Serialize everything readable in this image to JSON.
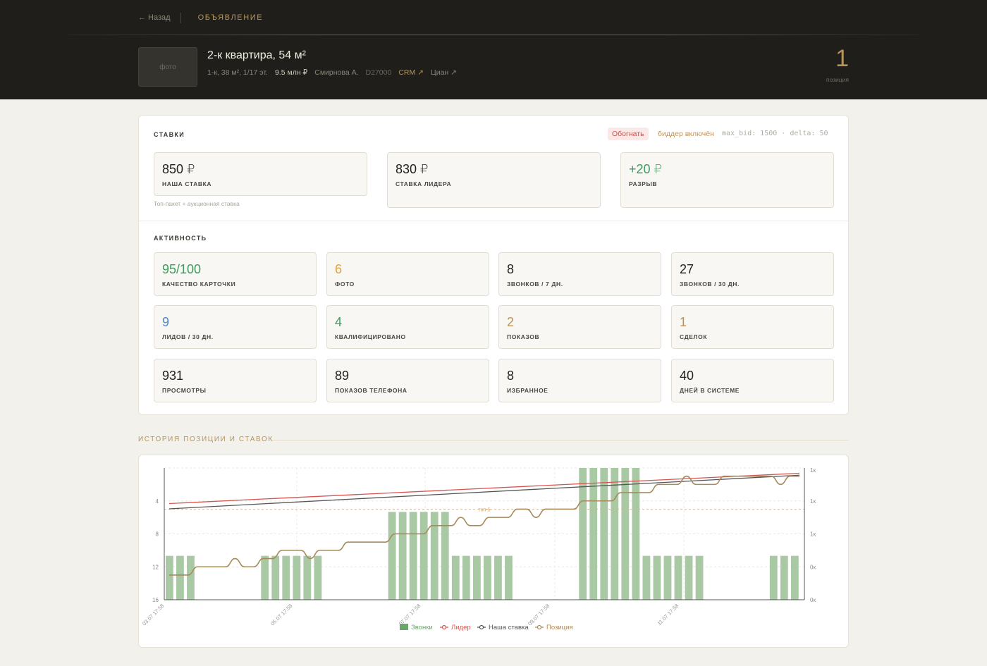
{
  "header": {
    "back_label": "← Назад",
    "crumb": "ОБЪЯВЛЕНИЕ",
    "photo_label": "фото",
    "title": "2-к квартира, 54 м²",
    "meta": {
      "details": "1-к, 38 м², 1/17 эт.",
      "price": "9.5 млн ₽",
      "agent": "Смирнова А.",
      "code": "D27000",
      "crm_link": "CRM ↗",
      "cian_link": "Циан ↗"
    },
    "position_value": "1",
    "position_label": "позиция"
  },
  "bids": {
    "section_title": "СТАВКИ",
    "action_pill": "Обогнать",
    "bidder_status": "биддер включён",
    "bidder_params": "max_bid: 1500 · delta: 50",
    "our_bid": {
      "value": "850 ₽",
      "label": "НАША СТАВКА",
      "note": "Топ-пакет + аукционная ставка"
    },
    "leader_bid": {
      "value": "830 ₽",
      "label": "СТАВКА ЛИДЕРА"
    },
    "gap": {
      "value": "+20 ₽",
      "label": "РАЗРЫВ"
    }
  },
  "activity": {
    "section_title": "АКТИВНОСТЬ",
    "tiles": [
      {
        "value": "95/100",
        "label": "КАЧЕСТВО КАРТОЧКИ",
        "color": "#3f9a5f"
      },
      {
        "value": "6",
        "label": "ФОТО",
        "color": "#e3a335"
      },
      {
        "value": "8",
        "label": "ЗВОНКОВ / 7 ДН.",
        "color": "#222222"
      },
      {
        "value": "27",
        "label": "ЗВОНКОВ / 30 ДН.",
        "color": "#222222"
      },
      {
        "value": "9",
        "label": "ЛИДОВ / 30 ДН.",
        "color": "#4e86cf"
      },
      {
        "value": "4",
        "label": "КВАЛИФИЦИРОВАНО",
        "color": "#3f9a5f"
      },
      {
        "value": "2",
        "label": "ПОКАЗОВ",
        "color": "#b9925a"
      },
      {
        "value": "1",
        "label": "СДЕЛОК",
        "color": "#b9925a"
      },
      {
        "value": "931",
        "label": "ПРОСМОТРЫ",
        "color": "#222222"
      },
      {
        "value": "89",
        "label": "ПОКАЗОВ ТЕЛЕФОНА",
        "color": "#222222"
      },
      {
        "value": "8",
        "label": "ИЗБРАННОЕ",
        "color": "#222222"
      },
      {
        "value": "40",
        "label": "ДНЕЙ В СИСТЕМЕ",
        "color": "#222222"
      }
    ]
  },
  "history_title": "ИСТОРИЯ ПОЗИЦИИ И СТАВОК",
  "chart_data": {
    "type": "bar",
    "title": "",
    "left_axis": {
      "ticks": [
        "4",
        "8",
        "12",
        "16"
      ],
      "ylim": [
        16,
        0
      ],
      "reversed": true
    },
    "right_axis": {
      "ticks": [
        "1к",
        "1к",
        "1к",
        "0к",
        "0к"
      ],
      "ylim": [
        0,
        1000
      ]
    },
    "x_tick_labels": [
      "03.07 17:58",
      "05.07 17:58",
      "07.07 17:58",
      "09.07 17:58",
      "11.07 17:58"
    ],
    "reference_line": {
      "label": "топ-5",
      "position": 5
    },
    "colors": {
      "calls": "#a9c9a5",
      "leader": "#d9534f",
      "our_bid": "#555555",
      "position": "#a68a5b"
    },
    "series": [
      {
        "name": "Звонки",
        "kind": "bar",
        "values": [
          1,
          1,
          1,
          0,
          0,
          0,
          0,
          0,
          0,
          1,
          1,
          1,
          1,
          1,
          1,
          0,
          0,
          0,
          0,
          0,
          0,
          2,
          2,
          2,
          2,
          2,
          2,
          1,
          1,
          1,
          1,
          1,
          1,
          0,
          0,
          0,
          0,
          0,
          0,
          3,
          3,
          3,
          3,
          3,
          3,
          1,
          1,
          1,
          1,
          1,
          1,
          0,
          0,
          0,
          0,
          0,
          0,
          1,
          1,
          1
        ]
      },
      {
        "name": "Лидер",
        "kind": "line",
        "values": [
          730,
          960
        ]
      },
      {
        "name": "Наша ставка",
        "kind": "line",
        "values": [
          690,
          945
        ]
      },
      {
        "name": "Позиция",
        "kind": "line",
        "values": [
          13,
          13,
          13,
          12,
          12,
          12,
          12,
          11,
          12,
          12,
          11,
          11,
          10,
          10,
          10,
          11,
          10,
          10,
          10,
          9,
          9,
          9,
          9,
          9,
          8,
          8,
          8,
          8,
          7,
          7,
          7,
          6,
          7,
          7,
          6,
          6,
          6,
          5,
          5,
          6,
          5,
          5,
          5,
          5,
          4,
          4,
          4,
          4,
          3,
          3,
          3,
          3,
          2,
          2,
          2,
          1,
          2,
          2,
          2,
          1,
          1,
          1,
          1,
          1,
          1,
          2,
          1,
          1
        ]
      }
    ],
    "legend": [
      "Звонки",
      "Лидер",
      "Наша ставка",
      "Позиция"
    ],
    "legend_placement": "bottom",
    "grid": true
  }
}
